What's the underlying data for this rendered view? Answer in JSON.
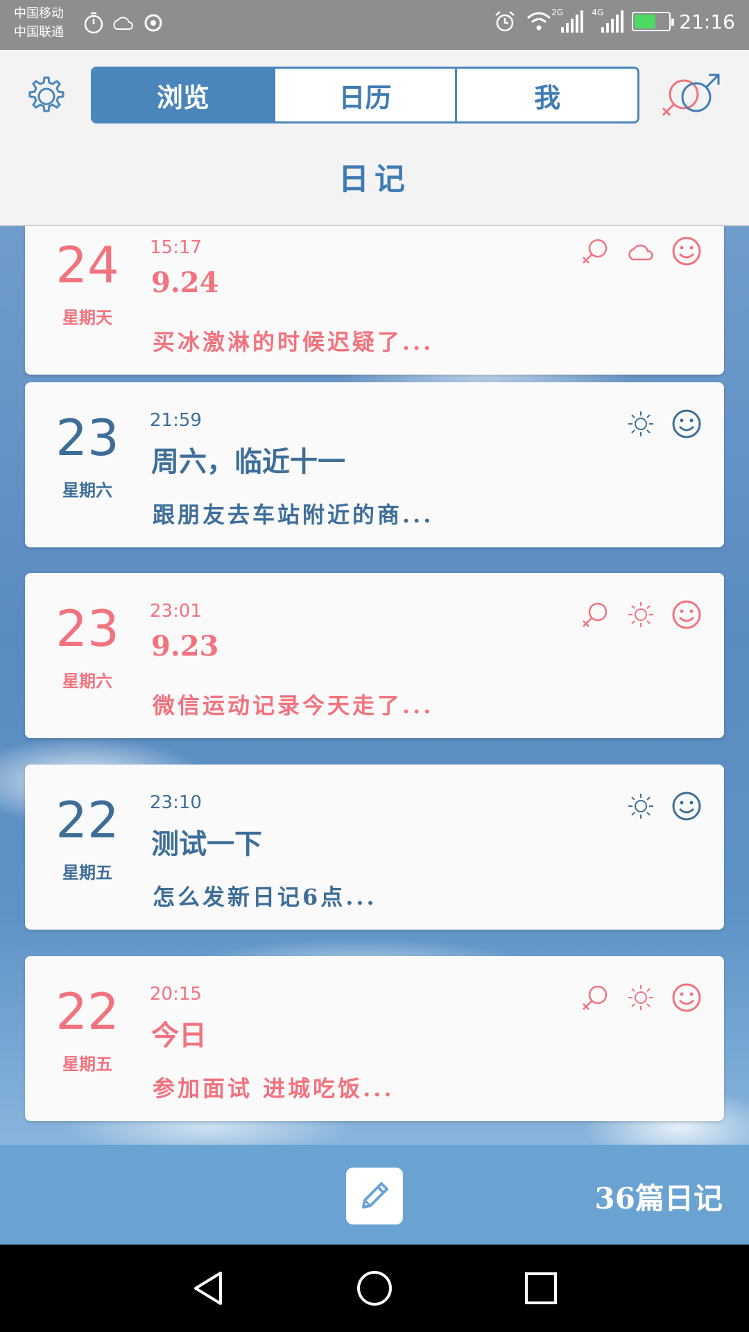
{
  "status_bar": {
    "carrier_1": "中国移动",
    "carrier_2": "中国联通",
    "network_1": "2G",
    "network_2": "4G",
    "time": "21:16"
  },
  "header": {
    "tabs": [
      {
        "label": "浏览",
        "active": true
      },
      {
        "label": "日历",
        "active": false
      },
      {
        "label": "我",
        "active": false
      }
    ],
    "title": "日记"
  },
  "entries": [
    {
      "day": "24",
      "weekday": "星期天",
      "time": "15:17",
      "title": "9.24",
      "preview": "买冰激淋的时候迟疑了...",
      "color": "pink",
      "icons": [
        "female-icon",
        "cloud-icon",
        "smiley-icon"
      ]
    },
    {
      "day": "23",
      "weekday": "星期六",
      "time": "21:59",
      "title": "周六，临近十一",
      "preview": "跟朋友去车站附近的商...",
      "color": "blue",
      "icons": [
        "sun-icon",
        "smiley-icon"
      ]
    },
    {
      "day": "23",
      "weekday": "星期六",
      "time": "23:01",
      "title": "9.23",
      "preview": "微信运动记录今天走了...",
      "color": "pink",
      "icons": [
        "female-icon",
        "sun-icon",
        "smiley-icon"
      ]
    },
    {
      "day": "22",
      "weekday": "星期五",
      "time": "23:10",
      "title": "测试一下",
      "preview": "怎么发新日记6点...",
      "color": "blue",
      "icons": [
        "sun-icon",
        "smiley-icon"
      ]
    },
    {
      "day": "22",
      "weekday": "星期五",
      "time": "20:15",
      "title": "今日",
      "preview": "参加面试 进城吃饭...",
      "color": "pink",
      "icons": [
        "female-icon",
        "sun-icon",
        "smiley-icon"
      ]
    }
  ],
  "bottom_bar": {
    "count_label": "36篇日记"
  },
  "colors": {
    "pink": "#f2727e",
    "blue": "#3e6e98",
    "accent": "#4a86bb"
  }
}
